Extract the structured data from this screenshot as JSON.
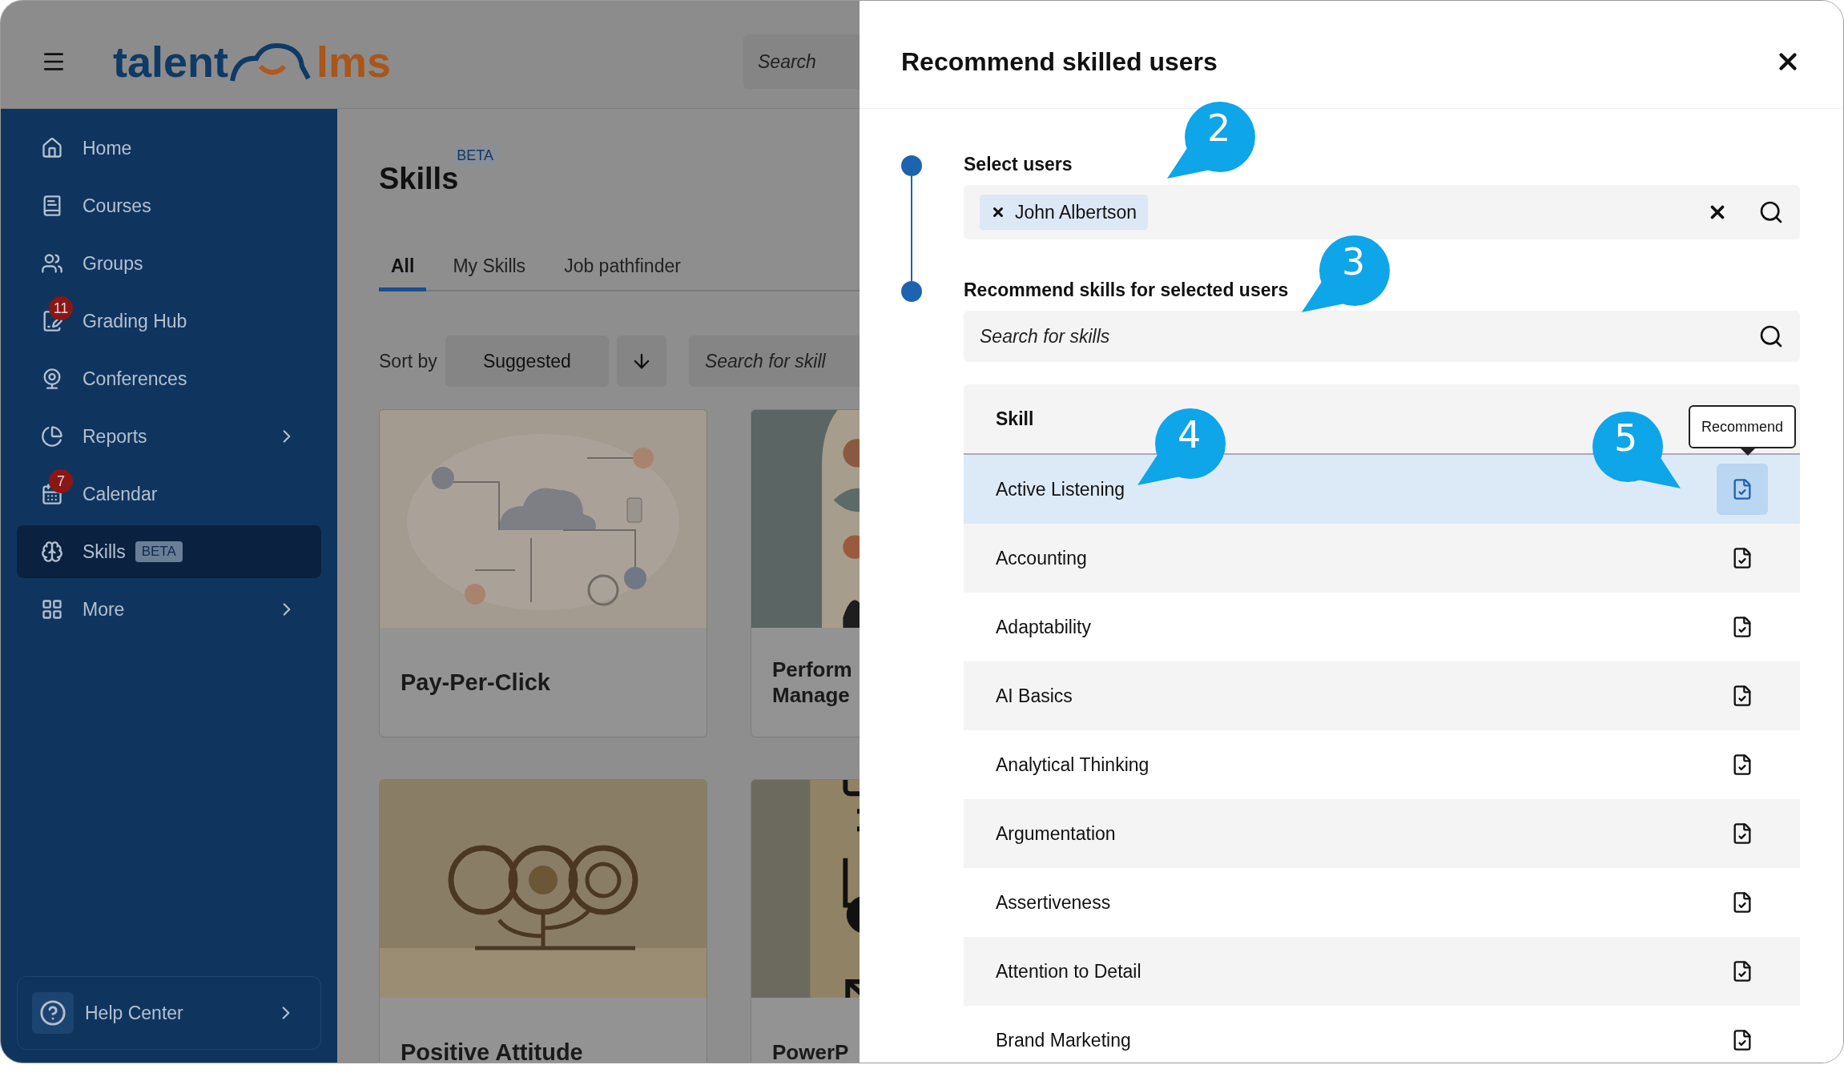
{
  "header": {
    "logo": {
      "left": "talent",
      "right": "lms"
    },
    "search": {
      "placeholder": "Search"
    }
  },
  "sidebar": {
    "items": [
      {
        "label": "Home",
        "selected": false
      },
      {
        "label": "Courses",
        "selected": false
      },
      {
        "label": "Groups",
        "selected": false
      },
      {
        "label": "Grading Hub",
        "badge": "11",
        "selected": false
      },
      {
        "label": "Conferences",
        "selected": false
      },
      {
        "label": "Reports",
        "expandable": true,
        "selected": false
      },
      {
        "label": "Calendar",
        "badge": "7",
        "selected": false
      },
      {
        "label": "Skills",
        "tag": "BETA",
        "selected": true
      },
      {
        "label": "More",
        "expandable": true,
        "selected": false
      }
    ],
    "help": {
      "label": "Help Center"
    }
  },
  "page": {
    "title": "Skills",
    "title_tag": "BETA",
    "tabs": [
      {
        "label": "All",
        "selected": true
      },
      {
        "label": "My Skills",
        "selected": false
      },
      {
        "label": "Job pathfinder",
        "selected": false
      }
    ],
    "sort": {
      "label": "Sort by",
      "value": "Suggested"
    },
    "search": {
      "placeholder": "Search for skill"
    },
    "cards": [
      {
        "title": "Pay-Per-Click",
        "kind": "network"
      },
      {
        "title": "Perform Manage",
        "kind": "arch"
      },
      {
        "title": "Positive Attitude",
        "kind": "gears"
      },
      {
        "title": "PowerP",
        "kind": "flow"
      }
    ]
  },
  "panel": {
    "title": "Recommend skilled users",
    "steps": [
      {
        "label": "Select users"
      },
      {
        "label": "Recommend skills for selected users"
      }
    ],
    "users": [
      {
        "name": "John Albertson"
      }
    ],
    "skill_search": {
      "placeholder": "Search for skills"
    },
    "table": {
      "column": "Skill",
      "tooltip": "Recommend",
      "rows": [
        {
          "skill": "Active Listening",
          "selected": true
        },
        {
          "skill": "Accounting",
          "selected": false
        },
        {
          "skill": "Adaptability",
          "selected": false
        },
        {
          "skill": "AI Basics",
          "selected": false
        },
        {
          "skill": "Analytical Thinking",
          "selected": false
        },
        {
          "skill": "Argumentation",
          "selected": false
        },
        {
          "skill": "Assertiveness",
          "selected": false
        },
        {
          "skill": "Attention to Detail",
          "selected": false
        },
        {
          "skill": "Brand Marketing",
          "selected": false
        }
      ]
    }
  },
  "callouts": [
    {
      "label": "2"
    },
    {
      "label": "3"
    },
    {
      "label": "4"
    },
    {
      "label": "5"
    }
  ]
}
